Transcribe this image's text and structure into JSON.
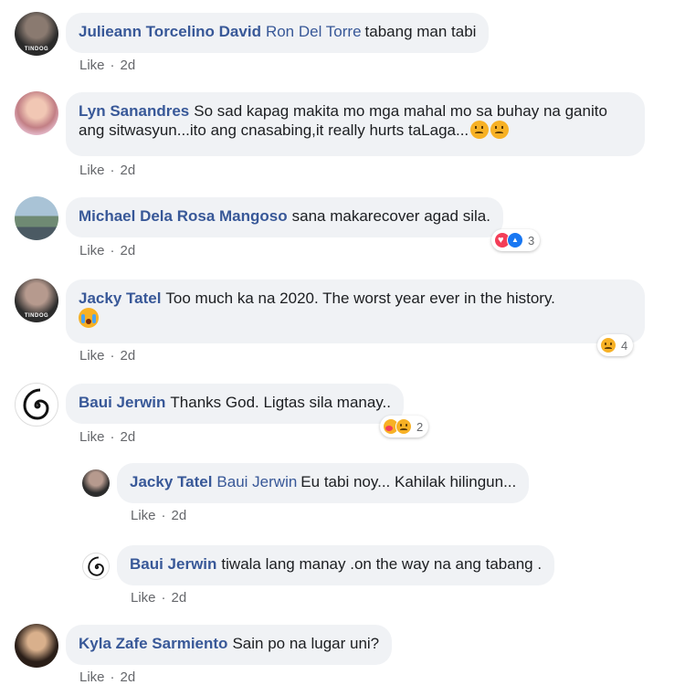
{
  "comments": [
    {
      "author": "Julieann Torcelino David",
      "mention": "Ron Del Torre",
      "text": "tabang man tabi",
      "like_label": "Like",
      "separator": "·",
      "time": "2d",
      "avatar_text": "TINDOG"
    },
    {
      "author": "Lyn Sanandres",
      "text": "So sad kapag makita mo mga mahal mo sa buhay na ganito ang sitwasyun...ito ang cnasabing,it really hurts taLaga...",
      "emojis": [
        "sad-face-emoji",
        "sad-face-emoji"
      ],
      "like_label": "Like",
      "separator": "·",
      "time": "2d"
    },
    {
      "author": "Michael Dela Rosa Mangoso",
      "text": "sana makarecover agad sila.",
      "like_label": "Like",
      "separator": "·",
      "time": "2d",
      "reactions": {
        "icons": [
          "heart-reaction-icon",
          "like-reaction-icon"
        ],
        "count": "3"
      }
    },
    {
      "author": "Jacky Tatel",
      "text": "Too much ka na 2020. The worst year ever in the history.",
      "emojis": [
        "crying-face-emoji"
      ],
      "like_label": "Like",
      "separator": "·",
      "time": "2d",
      "reactions": {
        "icons": [
          "sad-reaction-icon"
        ],
        "count": "4"
      },
      "avatar_text": "TINDOG"
    },
    {
      "author": "Baui Jerwin",
      "text": "Thanks God. Ligtas sila manay..",
      "like_label": "Like",
      "separator": "·",
      "time": "2d",
      "reactions": {
        "icons": [
          "care-reaction-icon",
          "sad-reaction-icon"
        ],
        "count": "2"
      }
    },
    {
      "author": "Jacky Tatel",
      "mention": "Baui Jerwin",
      "text": "Eu tabi noy... Kahilak hilingun...",
      "like_label": "Like",
      "separator": "·",
      "time": "2d",
      "reply": true
    },
    {
      "author": "Baui Jerwin",
      "text": "tiwala lang manay .on the way na ang tabang .",
      "like_label": "Like",
      "separator": "·",
      "time": "2d",
      "reply": true
    },
    {
      "author": "Kyla Zafe Sarmiento",
      "text": "Sain po na lugar uni?",
      "like_label": "Like",
      "separator": "·",
      "time": "2d"
    }
  ],
  "colors": {
    "author_link": "#385898",
    "bubble_bg": "#f0f2f5",
    "meta_text": "#65676b"
  }
}
